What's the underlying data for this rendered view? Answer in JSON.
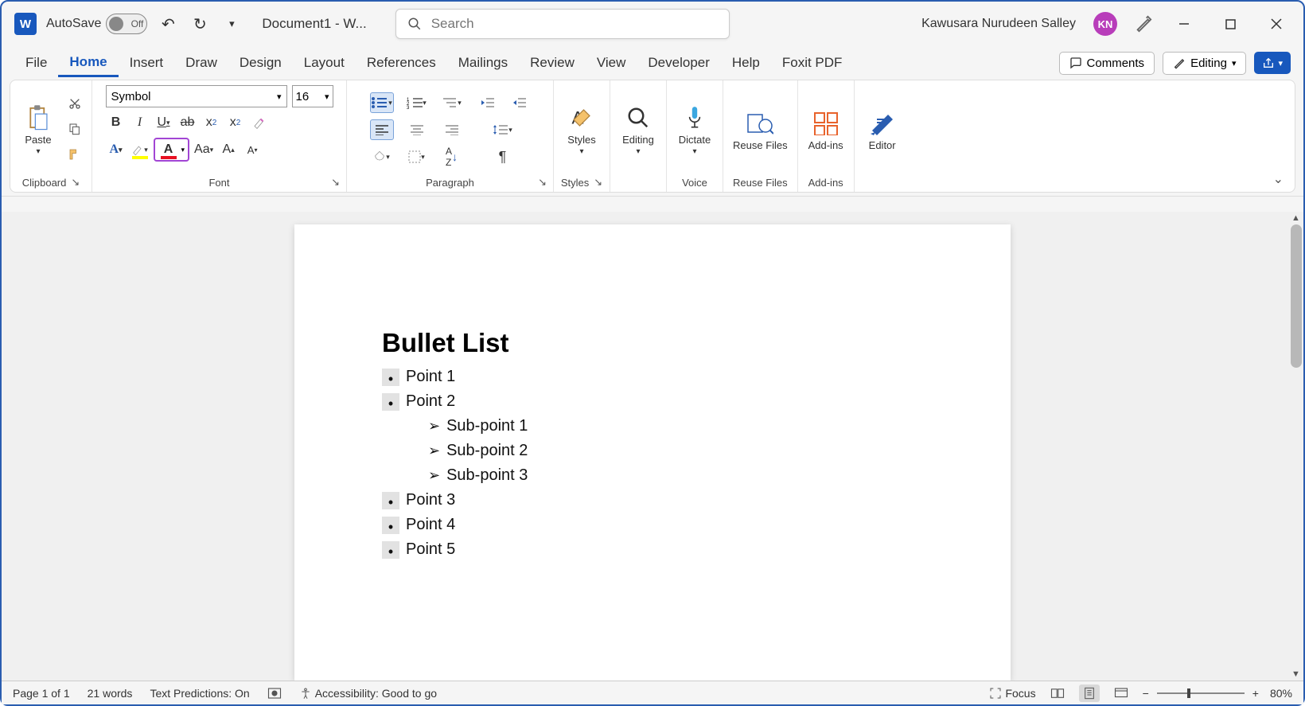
{
  "titlebar": {
    "autosave_label": "AutoSave",
    "autosave_state": "Off",
    "doc_title": "Document1  -  W...",
    "search_placeholder": "Search",
    "user_name": "Kawusara Nurudeen Salley",
    "user_initials": "KN"
  },
  "tabs": [
    "File",
    "Home",
    "Insert",
    "Draw",
    "Design",
    "Layout",
    "References",
    "Mailings",
    "Review",
    "View",
    "Developer",
    "Help",
    "Foxit PDF"
  ],
  "active_tab": "Home",
  "tab_actions": {
    "comments": "Comments",
    "editing": "Editing"
  },
  "ribbon": {
    "clipboard": {
      "paste": "Paste",
      "label": "Clipboard"
    },
    "font": {
      "name": "Symbol",
      "size": "16",
      "label": "Font"
    },
    "paragraph": {
      "label": "Paragraph"
    },
    "styles": {
      "btn": "Styles",
      "label": "Styles"
    },
    "editing": {
      "btn": "Editing"
    },
    "dictate": {
      "btn": "Dictate",
      "label": "Voice"
    },
    "reuse": {
      "btn": "Reuse Files",
      "label": "Reuse Files"
    },
    "addins": {
      "btn": "Add-ins",
      "label": "Add-ins"
    },
    "editor": {
      "btn": "Editor"
    }
  },
  "document": {
    "heading": "Bullet List",
    "items": [
      {
        "level": 0,
        "text": "Point 1"
      },
      {
        "level": 0,
        "text": "Point 2"
      },
      {
        "level": 1,
        "text": "Sub-point 1"
      },
      {
        "level": 1,
        "text": "Sub-point 2"
      },
      {
        "level": 1,
        "text": "Sub-point 3"
      },
      {
        "level": 0,
        "text": "Point 3"
      },
      {
        "level": 0,
        "text": "Point 4"
      },
      {
        "level": 0,
        "text": "Point 5"
      }
    ]
  },
  "statusbar": {
    "page": "Page 1 of 1",
    "words": "21 words",
    "predictions": "Text Predictions: On",
    "accessibility": "Accessibility: Good to go",
    "focus": "Focus",
    "zoom": "80%"
  }
}
